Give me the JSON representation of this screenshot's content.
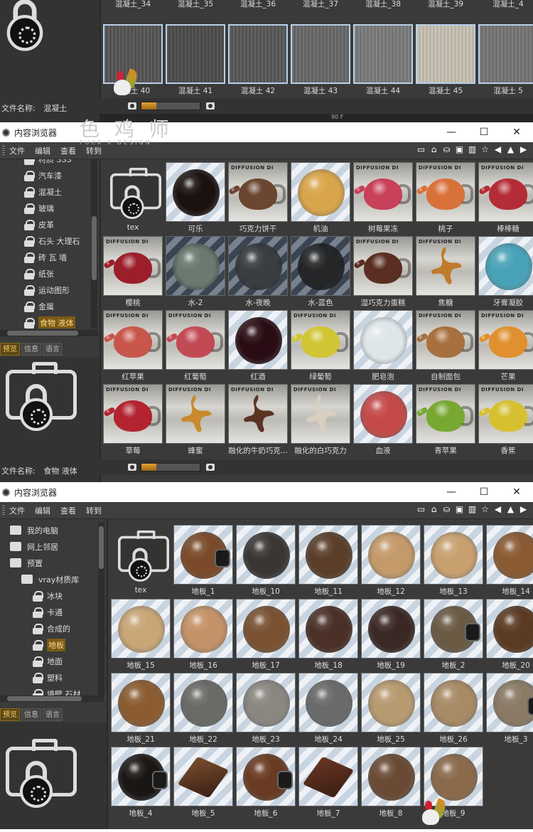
{
  "top_panel": {
    "row1": [
      "混凝土_34",
      "混凝土_35",
      "混凝土_36",
      "混凝土_37",
      "混凝土_38",
      "混凝土_39",
      "混凝土_4"
    ],
    "row2": [
      {
        "label": "混凝土 40",
        "tone": "#575757"
      },
      {
        "label": "混凝土 41",
        "tone": "#4e4e4e"
      },
      {
        "label": "混凝土 42",
        "tone": "#5a5a5a"
      },
      {
        "label": "混凝土 43",
        "tone": "#6a6a6a"
      },
      {
        "label": "混凝土 44",
        "tone": "#7d7d7d"
      },
      {
        "label": "混凝土 45",
        "tone": "#c9c3b5"
      },
      {
        "label": "混凝土 5",
        "tone": "#777777"
      }
    ],
    "filename_label": "文件名称:",
    "filename_value": "混凝土",
    "slider_fraction": 0.25,
    "extra_value": "90 F"
  },
  "watermark": {
    "text": "色 鸡 师",
    "sub": "FUCK X DESIGN"
  },
  "window2": {
    "title": "内容浏览器",
    "menus": [
      "文件",
      "编辑",
      "查看",
      "转到"
    ],
    "tree": [
      {
        "label": "材质 SSS",
        "selected": false
      },
      {
        "label": "汽车漆",
        "selected": false
      },
      {
        "label": "混凝土",
        "selected": false
      },
      {
        "label": "玻璃",
        "selected": false
      },
      {
        "label": "皮革",
        "selected": false
      },
      {
        "label": "石头 大理石",
        "selected": false
      },
      {
        "label": "砖 瓦 墙",
        "selected": false
      },
      {
        "label": "纸张",
        "selected": false
      },
      {
        "label": "运动图形",
        "selected": false
      },
      {
        "label": "金属",
        "selected": false
      },
      {
        "label": "食物 液体",
        "selected": true
      }
    ],
    "tabs": [
      "预览",
      "信息",
      "语言"
    ],
    "filename_label": "文件名称:",
    "filename_value": "食物 液体",
    "slider_fraction": 0.25,
    "items": [
      {
        "label": "tex",
        "kind": "tex"
      },
      {
        "label": "可乐",
        "kind": "sphere",
        "color": "#1b1210",
        "bg": "striped"
      },
      {
        "label": "巧克力饼干",
        "kind": "teapot",
        "color": "#6b4630"
      },
      {
        "label": "机油",
        "kind": "sphere",
        "color": "#d9a54a",
        "bg": "striped"
      },
      {
        "label": "树莓果冻",
        "kind": "teapot",
        "color": "#c8405a"
      },
      {
        "label": "桃子",
        "kind": "teapot",
        "color": "#d9713a"
      },
      {
        "label": "棒棒糖",
        "kind": "teapot",
        "color": "#b42c35"
      },
      {
        "label": "樱桃",
        "kind": "teapot",
        "color": "#9c1e2a"
      },
      {
        "label": "水-2",
        "kind": "sphere",
        "color": "#6a7a70",
        "bg": "dstriped"
      },
      {
        "label": "水-夜晚",
        "kind": "sphere",
        "color": "#3a3e42",
        "bg": "dstriped"
      },
      {
        "label": "水-蓝色",
        "kind": "sphere",
        "color": "#242628",
        "bg": "dstriped"
      },
      {
        "label": "湿巧克力蛋糕",
        "kind": "teapot",
        "color": "#5a2e22"
      },
      {
        "label": "焦糖",
        "kind": "splash",
        "color": "#c07a2e"
      },
      {
        "label": "牙膏凝胶",
        "kind": "sphere",
        "color": "#49a3b8",
        "bg": "striped"
      },
      {
        "label": "红苹果",
        "kind": "teapot",
        "color": "#c9564a"
      },
      {
        "label": "红葡萄",
        "kind": "teapot",
        "color": "#c24a55"
      },
      {
        "label": "红酒",
        "kind": "sphere",
        "color": "#2a0d14",
        "bg": "striped"
      },
      {
        "label": "绿葡萄",
        "kind": "teapot",
        "color": "#d2c534"
      },
      {
        "label": "肥皂泡",
        "kind": "sphere",
        "color": "#dfe6ea",
        "bg": "striped"
      },
      {
        "label": "自制面包",
        "kind": "teapot",
        "color": "#a8703e"
      },
      {
        "label": "芒果",
        "kind": "teapot",
        "color": "#e0902e"
      },
      {
        "label": "草莓",
        "kind": "teapot",
        "color": "#b32430"
      },
      {
        "label": "蜂蜜",
        "kind": "splash",
        "color": "#c88a2c"
      },
      {
        "label": "融化的牛奶巧克...",
        "kind": "splash",
        "color": "#5a3422"
      },
      {
        "label": "融化的白巧克力",
        "kind": "splash",
        "color": "#d8cfc0"
      },
      {
        "label": "血液",
        "kind": "sphere",
        "color": "#c44a48",
        "bg": "striped"
      },
      {
        "label": "青苹果",
        "kind": "teapot",
        "color": "#78a832"
      },
      {
        "label": "香蕉",
        "kind": "teapot",
        "color": "#d6c030"
      }
    ]
  },
  "window3": {
    "title": "内容浏览器",
    "menus": [
      "文件",
      "编辑",
      "查看",
      "转到"
    ],
    "tree": [
      {
        "label": "我的电脑",
        "indent": 0,
        "icon": "computer"
      },
      {
        "label": "网上邻居",
        "indent": 0,
        "icon": "network"
      },
      {
        "label": "预置",
        "indent": 0,
        "icon": "preset"
      },
      {
        "label": "vray材质库",
        "indent": 1,
        "icon": "library"
      },
      {
        "label": "冰块",
        "indent": 2,
        "icon": "lock"
      },
      {
        "label": "卡通",
        "indent": 2,
        "icon": "lock"
      },
      {
        "label": "合成的",
        "indent": 2,
        "icon": "lock"
      },
      {
        "label": "地板",
        "indent": 2,
        "icon": "lock",
        "selected": true
      },
      {
        "label": "地面",
        "indent": 2,
        "icon": "lock"
      },
      {
        "label": "塑料",
        "indent": 2,
        "icon": "lock"
      },
      {
        "label": "墙壁 石材",
        "indent": 2,
        "icon": "lock"
      }
    ],
    "tabs": [
      "预览",
      "信息",
      "语言"
    ],
    "items": [
      {
        "label": "tex",
        "kind": "tex"
      },
      {
        "label": "地板_1",
        "kind": "sphere",
        "color": "#7a4a2a",
        "dark": true
      },
      {
        "label": "地板_10",
        "kind": "sphere",
        "color": "#3a3634"
      },
      {
        "label": "地板_11",
        "kind": "sphere",
        "color": "#5a3e2a"
      },
      {
        "label": "地板_12",
        "kind": "sphere",
        "color": "#c49a6a"
      },
      {
        "label": "地板_13",
        "kind": "sphere",
        "color": "#c8a070"
      },
      {
        "label": "地板_14",
        "kind": "sphere",
        "color": "#8a5a32"
      },
      {
        "label": "地板_15",
        "kind": "sphere",
        "color": "#c8a676"
      },
      {
        "label": "地板_16",
        "kind": "sphere",
        "color": "#c49268"
      },
      {
        "label": "地板_17",
        "kind": "sphere",
        "color": "#7a5232"
      },
      {
        "label": "地板_18",
        "kind": "sphere",
        "color": "#4a3026"
      },
      {
        "label": "地板_19",
        "kind": "sphere",
        "color": "#3a2824"
      },
      {
        "label": "地板_2",
        "kind": "sphere",
        "color": "#6a5a44",
        "dark": true
      },
      {
        "label": "地板_20",
        "kind": "sphere",
        "color": "#5a3a22"
      },
      {
        "label": "地板_21",
        "kind": "sphere",
        "color": "#8a5c30"
      },
      {
        "label": "地板_22",
        "kind": "sphere",
        "color": "#6a6a66"
      },
      {
        "label": "地板_23",
        "kind": "sphere",
        "color": "#8a8680"
      },
      {
        "label": "地板_24",
        "kind": "sphere",
        "color": "#6a6a6a"
      },
      {
        "label": "地板_25",
        "kind": "sphere",
        "color": "#b89a70"
      },
      {
        "label": "地板_26",
        "kind": "sphere",
        "color": "#a88a66"
      },
      {
        "label": "地板_3",
        "kind": "sphere",
        "color": "#8a7a66",
        "dark": true
      },
      {
        "label": "地板_4",
        "kind": "sphere",
        "color": "#1a1614",
        "dark": true
      },
      {
        "label": "地板_5",
        "kind": "cube",
        "color": "#7a4e2e"
      },
      {
        "label": "地板_6",
        "kind": "sphere",
        "color": "#6a3a22",
        "dark": true
      },
      {
        "label": "地板_7",
        "kind": "cube",
        "color": "#6a3424"
      },
      {
        "label": "地板_8",
        "kind": "sphere",
        "color": "#6a4a34"
      },
      {
        "label": "地板_9",
        "kind": "sphere",
        "color": "#8a6a4a"
      }
    ]
  }
}
